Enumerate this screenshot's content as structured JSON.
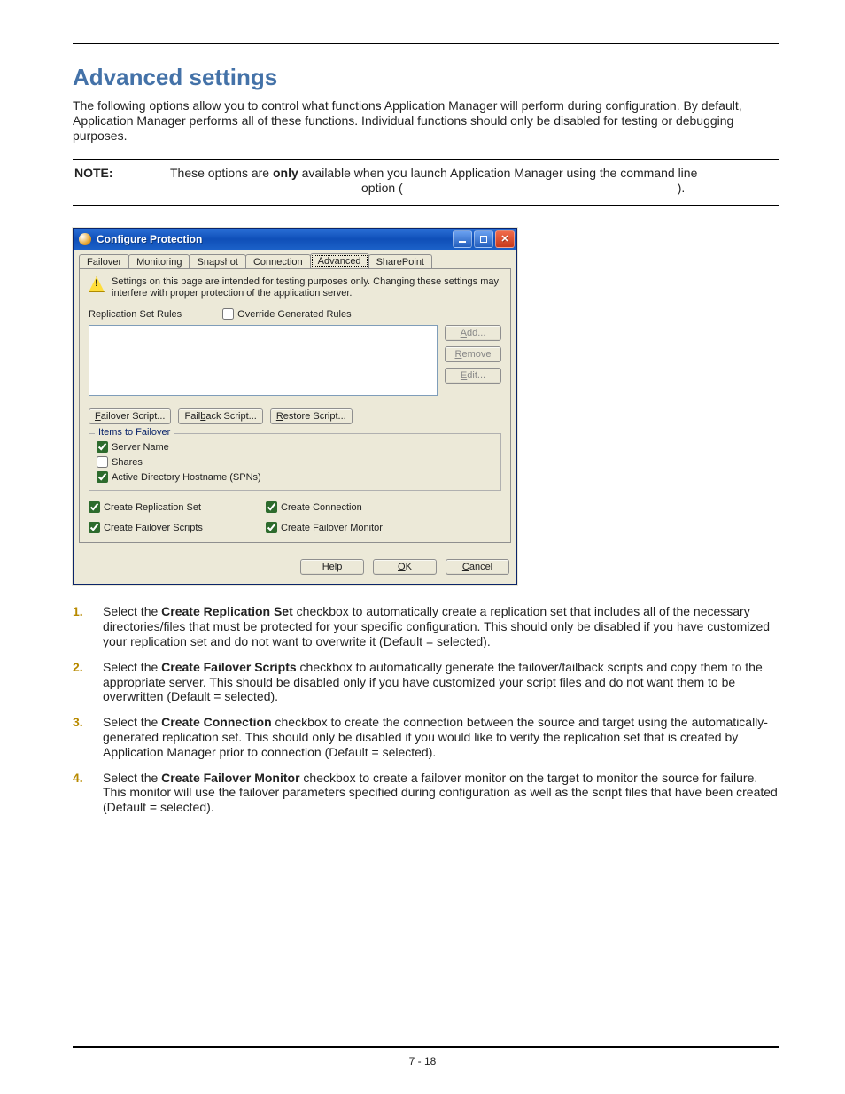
{
  "page": {
    "title": "Advanced settings",
    "intro": "The following options allow you to control what functions Application Manager will perform during configuration. By default, Application Manager performs all of these functions. Individual functions should only be disabled for testing or debugging purposes.",
    "footer": "7 - 18"
  },
  "note": {
    "label": "NOTE:",
    "text_pre": "These options are ",
    "only": "only",
    "text_mid": " available when you launch Application Manager using the command line",
    "gap": "option (",
    "tail": ")."
  },
  "dialog": {
    "title": "Configure Protection",
    "tabs": [
      "Failover",
      "Monitoring",
      "Snapshot",
      "Connection",
      "Advanced",
      "SharePoint"
    ],
    "active_tab": "Advanced",
    "warning": "Settings on this page are intended for testing purposes only.  Changing these settings may interfere with proper protection of the application server.",
    "rules_label": "Replication Set Rules",
    "override_label": "Override Generated Rules",
    "btn_add": "Add...",
    "btn_add_mn": "A",
    "btn_remove": "Remove",
    "btn_remove_mn": "R",
    "btn_edit": "Edit...",
    "btn_edit_mn": "E",
    "btn_failover_script": "Failover Script...",
    "btn_failover_script_mn": "F",
    "btn_failback_script": "Failback Script...",
    "btn_failback_script_mn": "b",
    "btn_restore_script": "Restore Script...",
    "btn_restore_script_mn": "R",
    "group_title": "Items to Failover",
    "chk_server_name": "Server Name",
    "chk_shares": "Shares",
    "chk_ad_spn": "Active Directory Hostname (SPNs)",
    "chk_create_repl": "Create Replication Set",
    "chk_create_conn": "Create Connection",
    "chk_create_scripts": "Create Failover Scripts",
    "chk_create_monitor": "Create Failover Monitor",
    "btn_help": "Help",
    "btn_ok": "OK",
    "btn_ok_mn": "O",
    "btn_cancel": "Cancel",
    "btn_cancel_mn": "C"
  },
  "steps": {
    "s1_pre": "Select the ",
    "s1_b": "Create Replication Set",
    "s1_post": " checkbox to automatically create a replication set that includes all of the necessary directories/files that must be protected for your specific configuration. This should only be disabled if you have customized your replication set and do not want to overwrite it (Default = selected).",
    "s2_pre": "Select the ",
    "s2_b": "Create Failover Scripts",
    "s2_post": " checkbox to automatically generate the failover/failback scripts and copy them to the appropriate server. This should be disabled only if you have customized your script files and do not want them to be overwritten (Default = selected).",
    "s3_pre": "Select the ",
    "s3_b": "Create Connection",
    "s3_post": " checkbox to create the connection between the source and target using the automatically-generated replication set. This should only be disabled if you would like to verify the replication set that is created by Application Manager prior to connection (Default = selected).",
    "s4_pre": "Select the ",
    "s4_b": "Create Failover Monitor",
    "s4_post": " checkbox to create a failover monitor on the target to monitor the source for failure. This monitor will use the failover parameters specified during configuration as well as the script files that have been created (Default = selected)."
  }
}
